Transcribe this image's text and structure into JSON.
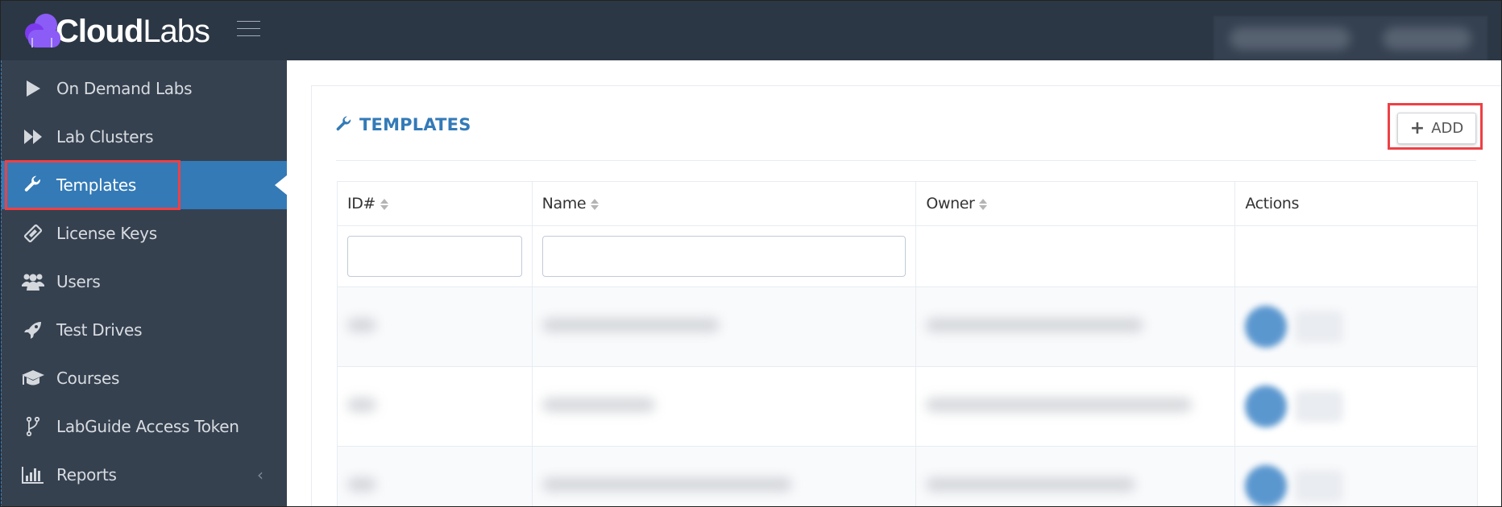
{
  "brand": {
    "name_bold": "Cloud",
    "name_light": "Labs",
    "colors": {
      "header_bg": "#2c3745",
      "sidebar_bg": "#364150",
      "accent": "#337ab7",
      "logo": "#8b5cf6",
      "highlight": "#ee4045"
    }
  },
  "sidebar": {
    "items": [
      {
        "label": "On Demand Labs",
        "icon": "play-icon"
      },
      {
        "label": "Lab Clusters",
        "icon": "fast-forward-icon"
      },
      {
        "label": "Templates",
        "icon": "wrench-icon",
        "active": true
      },
      {
        "label": "License Keys",
        "icon": "ticket-icon"
      },
      {
        "label": "Users",
        "icon": "users-icon"
      },
      {
        "label": "Test Drives",
        "icon": "rocket-icon"
      },
      {
        "label": "Courses",
        "icon": "graduation-cap-icon"
      },
      {
        "label": "LabGuide Access Token",
        "icon": "code-fork-icon"
      },
      {
        "label": "Reports",
        "icon": "bar-chart-icon",
        "expandable": true
      }
    ]
  },
  "panel": {
    "title": "TEMPLATES",
    "add_button_label": "ADD"
  },
  "table": {
    "columns": [
      {
        "label": "ID#",
        "sortable": true
      },
      {
        "label": "Name",
        "sortable": true
      },
      {
        "label": "Owner",
        "sortable": true
      },
      {
        "label": "Actions",
        "sortable": false
      }
    ],
    "filters": {
      "id_value": "",
      "name_value": ""
    },
    "rows_note": "row contents redacted (blurred)",
    "row_count_visible": 3
  }
}
